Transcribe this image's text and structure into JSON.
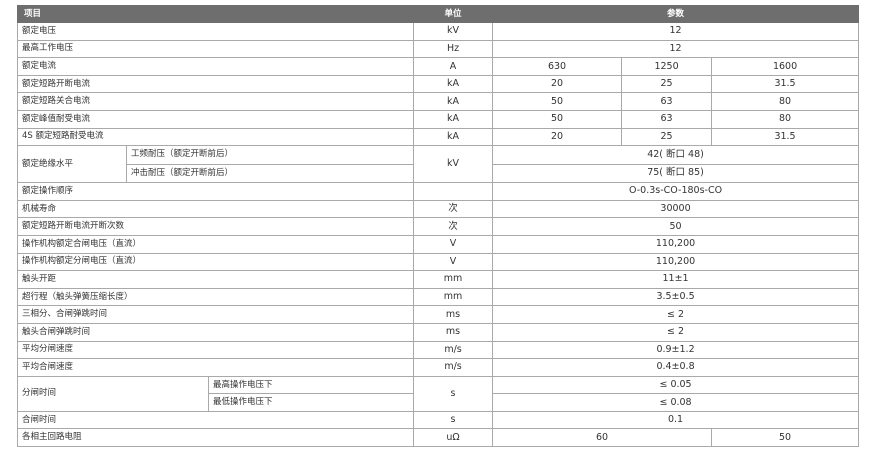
{
  "header": {
    "item": "项目",
    "unit": "单位",
    "params": "参数"
  },
  "rows": {
    "rated_voltage": {
      "label": "额定电压",
      "unit": "kV",
      "value": "12"
    },
    "max_voltage": {
      "label": "最高工作电压",
      "unit": "Hz",
      "value": "12"
    },
    "rated_current": {
      "label": "额定电流",
      "unit": "A",
      "values": [
        "630",
        "1250",
        "1600"
      ]
    },
    "short_break": {
      "label": "额定短路开断电流",
      "unit": "kA",
      "values": [
        "20",
        "25",
        "31.5"
      ]
    },
    "short_make": {
      "label": "额定短路关合电流",
      "unit": "kA",
      "values": [
        "50",
        "63",
        "80"
      ]
    },
    "peak_withstand": {
      "label": "额定峰值耐受电流",
      "unit": "kA",
      "values": [
        "50",
        "63",
        "80"
      ]
    },
    "short_withstand_4s": {
      "label": "4S 额定短路耐受电流",
      "unit": "kA",
      "values": [
        "20",
        "25",
        "31.5"
      ]
    },
    "insulation": {
      "label": "额定绝缘水平",
      "unit": "kV",
      "sub": [
        {
          "label": "工频耐压（额定开断前后）",
          "value": "42( 断口 48)"
        },
        {
          "label": "冲击耐压（额定开断前后）",
          "value": "75( 断口 85)"
        }
      ]
    },
    "op_sequence": {
      "label": "额定操作顺序",
      "unit": "",
      "value": "O-0.3s-CO-180s-CO"
    },
    "mech_life": {
      "label": "机械寿命",
      "unit": "次",
      "value": "30000"
    },
    "break_count": {
      "label": "额定短路开断电流开断次数",
      "unit": "次",
      "value": "50"
    },
    "close_voltage": {
      "label": "操作机构额定合闸电压（直流）",
      "unit": "V",
      "value": "110,200"
    },
    "open_voltage": {
      "label": "操作机构额定分闸电压（直流）",
      "unit": "V",
      "value": "110,200"
    },
    "contact_gap": {
      "label": "触头开距",
      "unit": "mm",
      "value": "11±1"
    },
    "overtravel": {
      "label": "超行程（触头弹簧压缩长度）",
      "unit": "mm",
      "value": "3.5±0.5"
    },
    "three_phase": {
      "label": "三相分、合闸弹跳时间",
      "unit": "ms",
      "value": "≤ 2"
    },
    "contact_bounce": {
      "label": "触头合闸弹跳时间",
      "unit": "ms",
      "value": "≤ 2"
    },
    "avg_open_speed": {
      "label": "平均分闸速度",
      "unit": "m/s",
      "value": "0.9±1.2"
    },
    "avg_close_speed": {
      "label": "平均合闸速度",
      "unit": "m/s",
      "value": "0.4±0.8"
    },
    "open_time": {
      "label": "分闸时间",
      "unit": "s",
      "sub": [
        {
          "label": "最高操作电压下",
          "value": "≤ 0.05"
        },
        {
          "label": "最低操作电压下",
          "value": "≤ 0.08"
        }
      ]
    },
    "close_time": {
      "label": "合闸时间",
      "unit": "s",
      "value": "0.1"
    },
    "main_resistance": {
      "label": "各相主回路电阻",
      "unit": "uΩ",
      "values": [
        "60",
        "50"
      ]
    }
  }
}
